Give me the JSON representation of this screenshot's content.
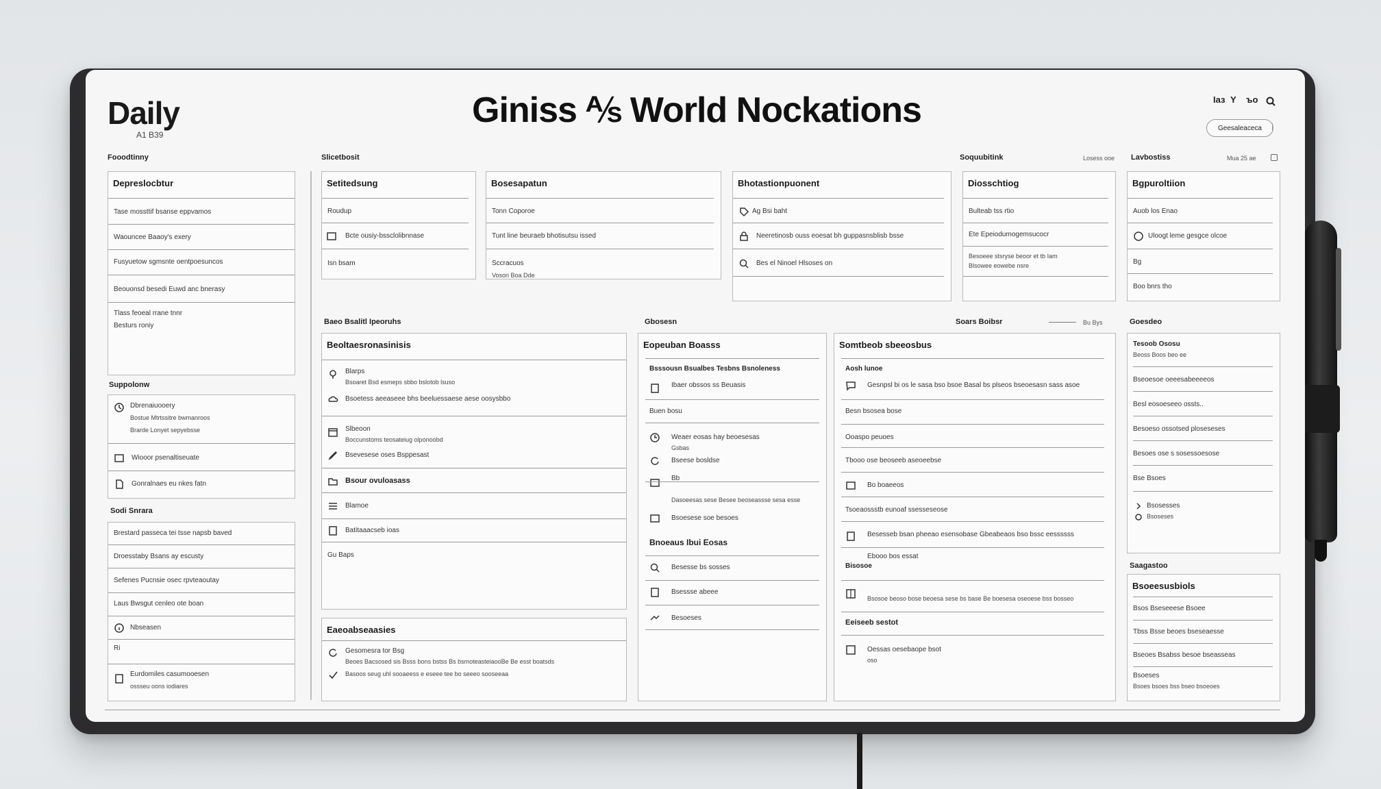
{
  "header": {
    "brand": "Daily",
    "brand_sub": "A1 B39",
    "title": "Giniss ⅍ World Nockations",
    "toolbar": [
      "Iаз",
      "Y",
      "ъо"
    ],
    "pill_label": "Geesaleaceca"
  },
  "left": {
    "section_label": "Fooodtinny",
    "card": {
      "title": "Depreslocbtur",
      "rows": [
        "Tase mossttif bsanse eppvamos",
        "Waouncee Baaoy's exery",
        "Fusyuetow sgmsnte oentpoesuncos",
        "Beouonsd besedi Euwd anc bnerasy",
        "Tlass feoeal rrane tnnr",
        "Besturs roniy"
      ]
    },
    "section2": "Suppolonw",
    "list2": {
      "items": [
        {
          "title": "Dbrenaiuooery",
          "sub": "Bostue Mtrtssitre bwmanroos",
          "sub2": "Brarde Lonyet sepyebsse"
        },
        {
          "title": "Wiooor psenaltiseuate"
        },
        {
          "title": "Gonralnaes eu nkes fatn"
        }
      ]
    },
    "section3": "Sodi Snrara",
    "list3": {
      "rows": [
        "Brestard passeca tei tsse napsb baved",
        "Droesstaby Bsans ay escusty",
        "Sefenes Pucnsie osec rpvteaoutay",
        "Laus Bwsgut cenleo ote boan",
        "Nbseasen",
        "Ri",
        "Eurdomiles casumooesen",
        "ossseu oons iodiares"
      ]
    }
  },
  "top_row": {
    "section_label": "Slicetbosit",
    "cards": [
      {
        "title": "Setitedsung",
        "rows": [
          "Roudup",
          "Bcte ousiy-bssclolibnnase",
          "Isn bsam"
        ]
      },
      {
        "title": "Bosesapatun",
        "rows": [
          "Tonn Coporoe",
          "Tunt line beuraeb bhotisutsu issed",
          "Sccracuos",
          "Voson Boa Dde"
        ]
      },
      {
        "title": "Bhotastionpuonent",
        "rows": [
          "Ag Bsi baht",
          "Neeretinosb ouss eoesat bh guppasnsblisb bsse",
          "Bes el Ninoel Hlsoses on"
        ]
      },
      {
        "title": "Diosschtiog",
        "rows": [
          "Bulteab tss rtio",
          "Ete Epeiodumogemsucocr",
          "Besoeee stsryse beoor et tb Iam",
          "Blsowee eowebe nsre"
        ]
      },
      {
        "title": "Bgpuroltiion",
        "rows": [
          "Auob los Enao",
          "Uloogt leme gesgce olcoe",
          "Bg",
          "Boo bnrs tho"
        ]
      }
    ],
    "right_label": "Soquubitink",
    "right_meta": "Losess ooe",
    "far_label": "Lavbostiss",
    "far_meta": "Mua 25 ae"
  },
  "mid": {
    "label1": "Baeo Bsalitl Ipeoruhs",
    "label2": "Gbosesn",
    "label3": "Soars Boibsr",
    "label3_meta": "Bu Bys",
    "label4": "Goesdeo",
    "label5": "Saagastoo",
    "col1": {
      "title": "Beoltaesronasinisis",
      "rows": [
        {
          "text": "Blarps",
          "sub": "Bsoaret Bsd esmeps sbbo bslotob lsuso"
        },
        {
          "text": "Bsoetess aeeaseee bhs beeluessaese aese oosysbbo"
        },
        {
          "text": "Slbeoon",
          "sub": "Boccunstoms teosateiug olponoobd"
        },
        {
          "text": "Bsevesese oses Bsppesast"
        },
        {
          "text": "Bsour ovuloasass",
          "bold": true
        },
        {
          "text": "Blamoe"
        },
        {
          "text": "Batitaaacseb ioas"
        },
        {
          "text": "Gu Baps"
        }
      ],
      "footer_title": "Eaeoabseaasies",
      "footer_rows": [
        "Gesomesra tor Bsg",
        "Beoes Bacsosed sis Bsss bons bstss Bs bsmoteasteiaooBe Be esst boatsds",
        "Basoos seug uhl sooaeess e eseee tee bo seeeo sooseeaa"
      ]
    },
    "col2": {
      "title": "Eopeuban Boasss",
      "subhead": "Bsssousn Bsualbes Tesbns Bsnoleness",
      "rows": [
        "Ibaer obssos ss Beuasis",
        "Buen bosu",
        "Weaer eosas hay beoesesas",
        "Gsbas",
        "Bseese bosldse",
        "Bb",
        "Dasoeesas sese Besee beoseassse sesa esse",
        "Bsoesese soe besoes",
        "Bnoeaus Ibui Eosas",
        "Besesse bs sosses",
        "Bsessse abeee",
        "Besoeses"
      ]
    },
    "col3": {
      "title": "Somtbeob sbeeosbus",
      "subhead": "Aosh lunoe",
      "rows": [
        "Gesnpsl bi os le sasa bso bsoe Basal bs plseos bseoesasn sass asoe",
        "Besn bsosea bose",
        "Ooaspo peuoes",
        "Tbooo ose beoseeb aseoeebse",
        "Bo boaeeos",
        "Tsoeaossstb eunoaf ssesseseose",
        "Besesseb bsan pheeao esensobase Gbeabeaos bso bssc eessssss",
        "Ebooo bos essat",
        "Bisosoe",
        "Bsosoe beoso bose beoesa sese bs base Be boesesa oseoese bss bosseo",
        "Eeiseeb sestot",
        "Oessas oesebaope bsot",
        "oso"
      ]
    },
    "col4": {
      "rows": [
        {
          "title": "Tesoob Ososu",
          "sub": "Beoss Boos beo ee"
        },
        {
          "title": "Bseoesoe oeeesabeeeeos"
        },
        {
          "title": "Besl eosoeseeo ossts.."
        },
        {
          "title": "Besoeso ossotsed ploseseses"
        },
        {
          "title": "Besoes ose s sosessoesose"
        },
        {
          "title": "Bse Bsoes"
        },
        {
          "title": "Bsosesses",
          "sub": "Bsoseses"
        }
      ]
    },
    "col5": {
      "title": "Bsoeesusbiols",
      "rows": [
        "Bsos Bseseeese Bsoee",
        "Tbss Bsse beoes bseseaesse",
        "Bseoes Bsabss besoe bseasseas",
        "Bsoeses",
        "Bsoes bsoes bss bseo bsoeoes"
      ]
    }
  }
}
